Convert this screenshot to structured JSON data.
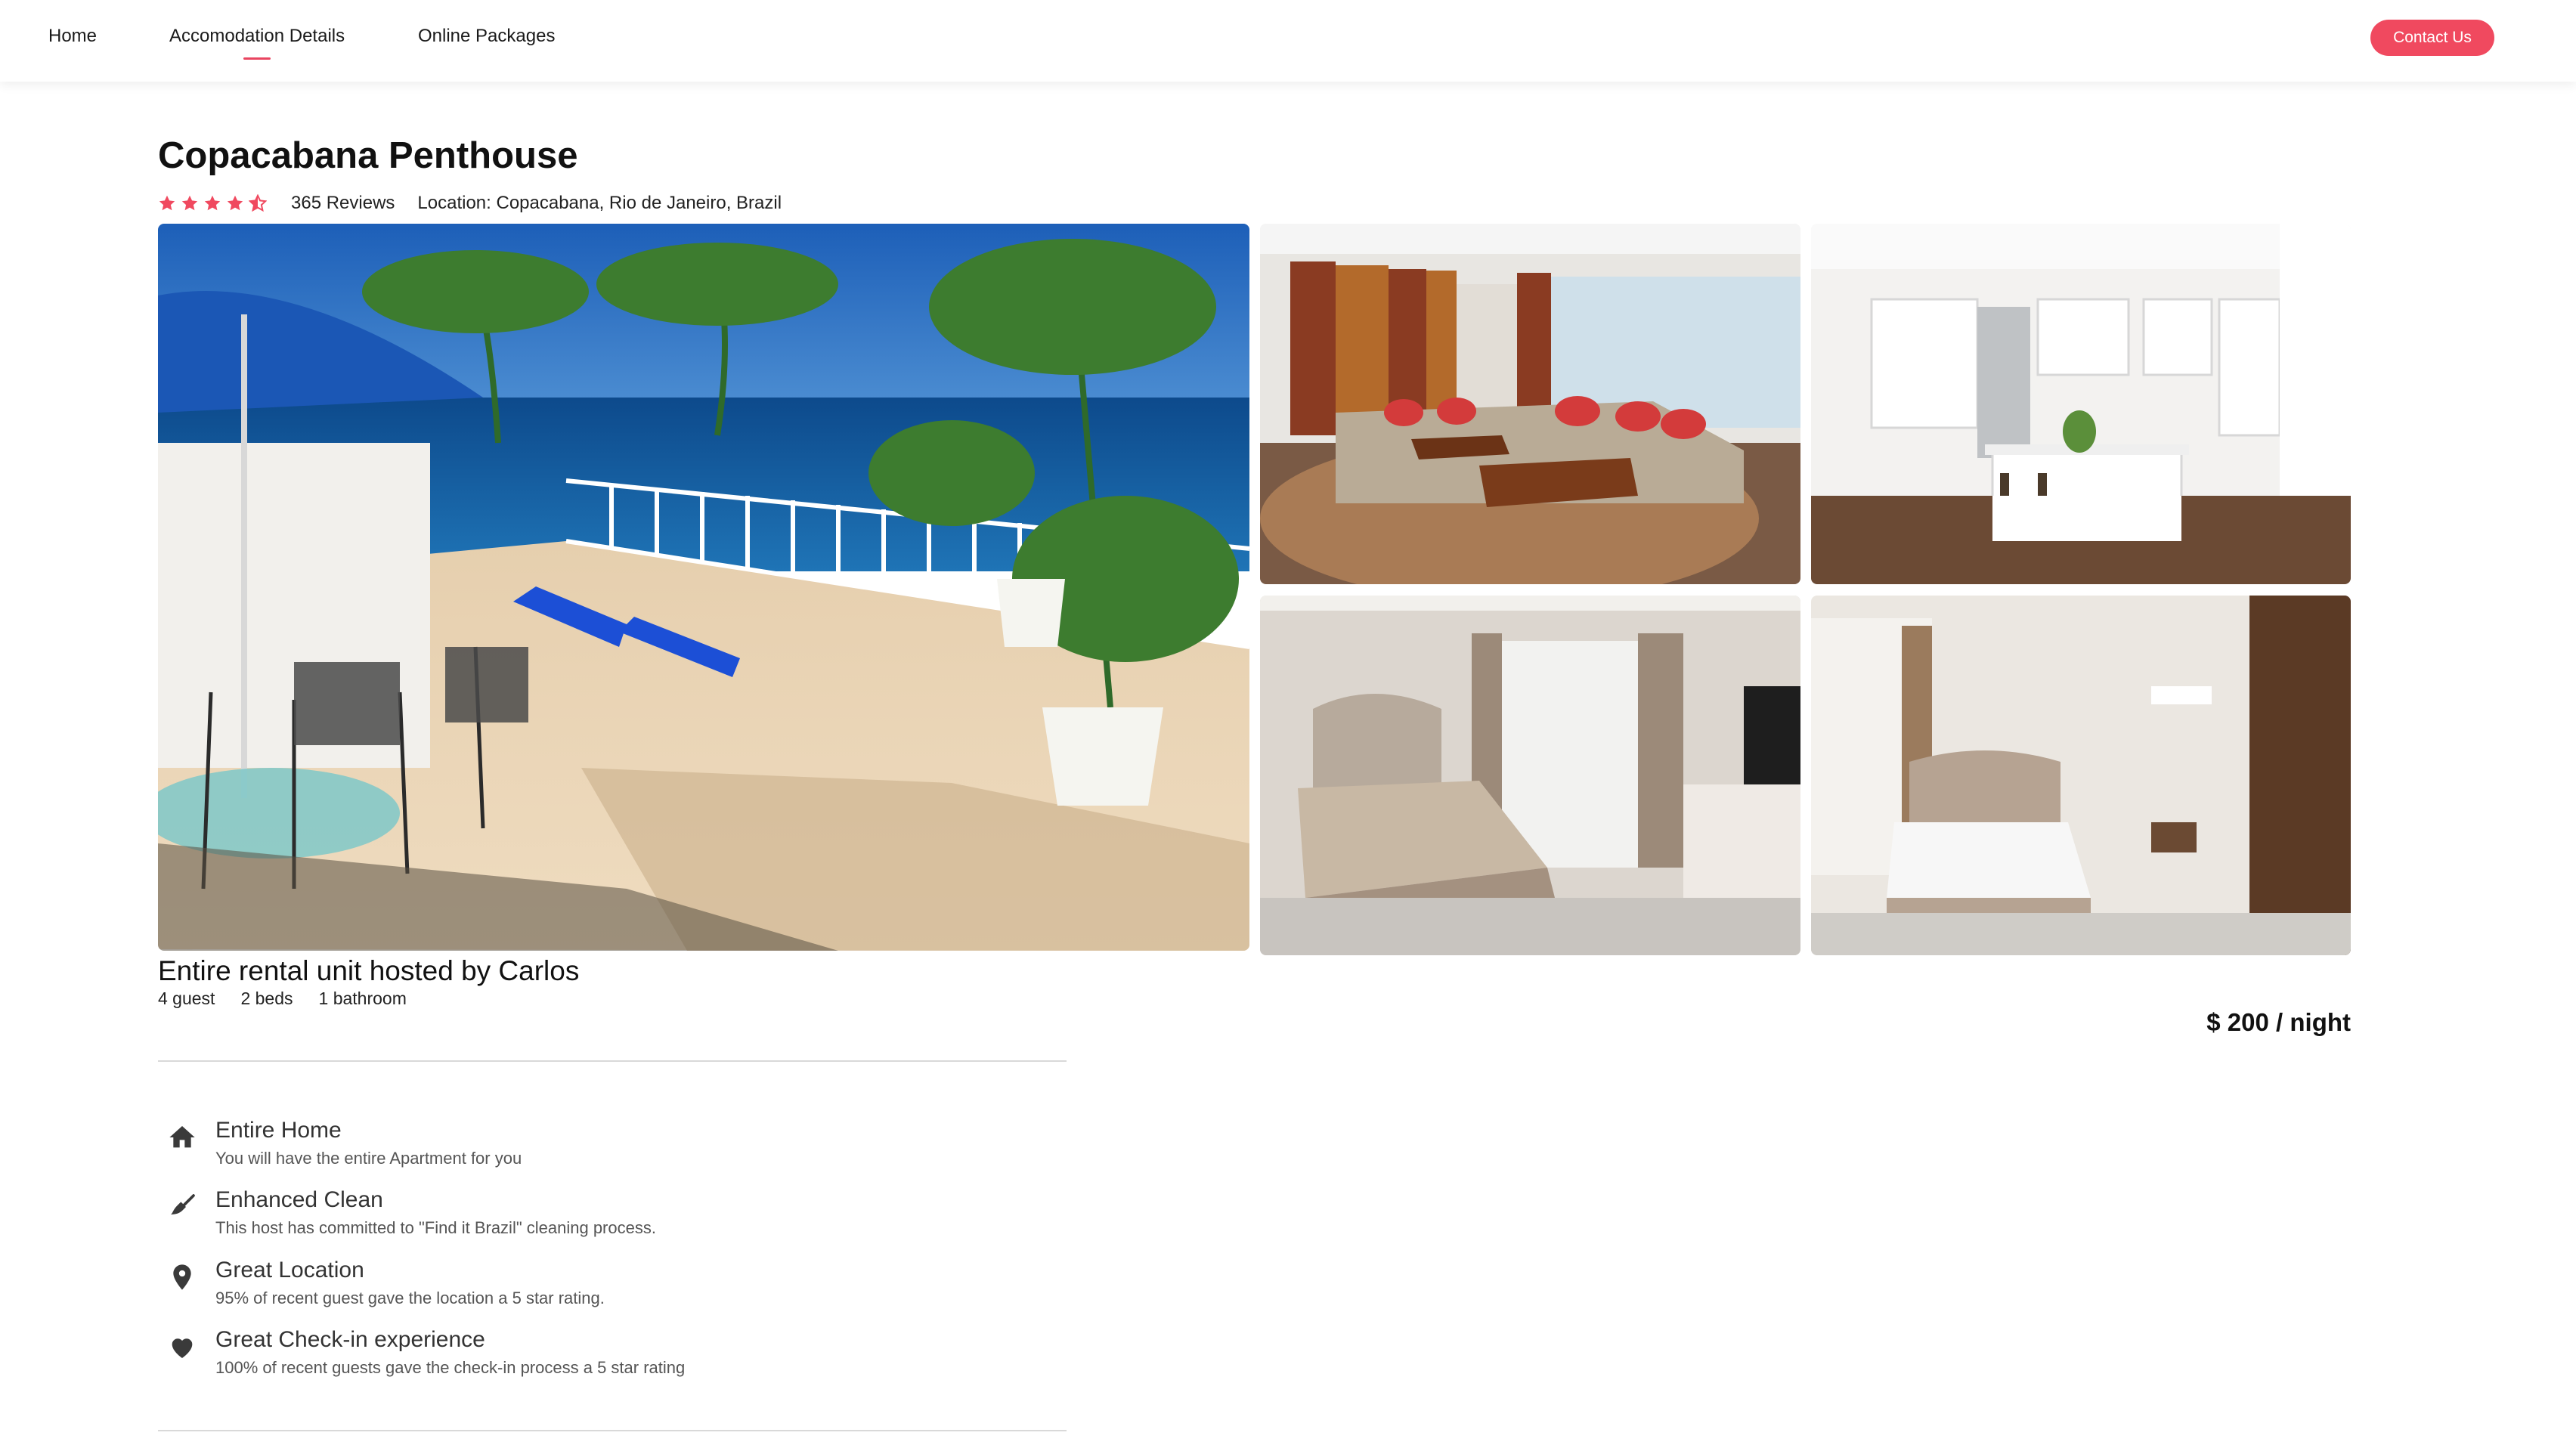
{
  "nav": {
    "links": [
      "Home",
      "Accomodation Details",
      "Online Packages"
    ],
    "active_index": 1,
    "contact_label": "Contact Us"
  },
  "listing": {
    "title": "Copacabana Penthouse",
    "rating": 4.5,
    "rating_max": 5,
    "reviews": "365 Reviews",
    "location": "Location: Copacabana, Rio de Janeiro, Brazil",
    "host_line": "Entire rental unit hosted by Carlos",
    "specs": [
      "4 guest",
      "2 beds",
      "1 bathroom"
    ],
    "price": "$ 200 / night"
  },
  "photos": [
    {
      "name": "photo-terrace-sea-view",
      "icon": "terrace-photo"
    },
    {
      "name": "photo-living-room",
      "icon": "living-room-photo"
    },
    {
      "name": "photo-kitchen",
      "icon": "kitchen-photo"
    },
    {
      "name": "photo-bedroom-1",
      "icon": "bedroom-photo"
    },
    {
      "name": "photo-bedroom-2",
      "icon": "bedroom-photo"
    }
  ],
  "features": [
    {
      "icon": "home-icon",
      "title": "Entire Home",
      "desc": "You will have the entire Apartment for you"
    },
    {
      "icon": "broom-icon",
      "title": "Enhanced Clean",
      "desc": "This host has committed to \"Find it Brazil\" cleaning process."
    },
    {
      "icon": "location-pin-icon",
      "title": "Great Location",
      "desc": "95% of recent guest gave the location a 5 star rating."
    },
    {
      "icon": "heart-icon",
      "title": "Great Check-in experience",
      "desc": "100% of recent guests gave the check-in process a 5 star rating"
    }
  ],
  "colors": {
    "accent": "#f0495f",
    "star": "#f0495f",
    "icon": "#3a3a3a",
    "divider": "#d9d9d9"
  }
}
